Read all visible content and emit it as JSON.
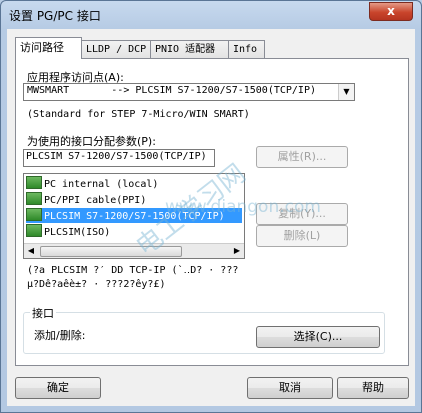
{
  "window": {
    "title": "设置 PG/PC 接口",
    "close": "x"
  },
  "tabs": [
    "访问路径",
    "LLDP / DCP",
    "PNIO 适配器",
    "Info"
  ],
  "access_point": {
    "label": "应用程序访问点(A):",
    "value": "MWSMART       --> PLCSIM S7-1200/S7-1500(TCP/IP)",
    "note": "(Standard for STEP 7-Micro/WIN SMART)"
  },
  "params": {
    "label": "为使用的接口分配参数(P):",
    "value": "PLCSIM S7-1200/S7-1500(TCP/IP)"
  },
  "buttons": {
    "properties": "属性(R)...",
    "copy": "复制(Y)...",
    "delete": "删除(L)",
    "select": "选择(C)...",
    "ok": "确定",
    "cancel": "取消",
    "help": "帮助"
  },
  "interfaces": [
    {
      "label": "PC internal (local)"
    },
    {
      "label": "PC/PPI cable(PPI)"
    },
    {
      "label": "PLCSIM S7-1200/S7-1500(TCP/IP)"
    },
    {
      "label": "PLCSIM(ISO)"
    }
  ],
  "selected_interface": 2,
  "garbled": {
    "line1": "(?a PLCSIM ?′ DD TCP-IP (`‥D? · ???",
    "line2": "μ?Dê?aêè±? · ???2?êy?£)"
  },
  "group": {
    "caption": "接口",
    "add_remove": "添加/删除:"
  },
  "watermark": {
    "url": "www.diangon.com",
    "text": "电工学习网"
  }
}
